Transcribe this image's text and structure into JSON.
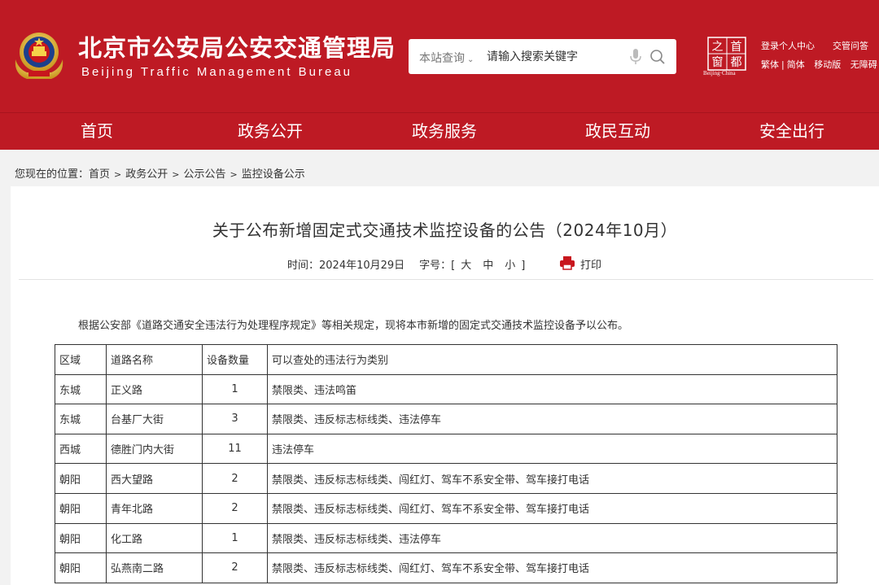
{
  "header": {
    "title": "北京市公安局公安交通管理局",
    "subtitle": "Beijing Traffic Management Bureau",
    "search": {
      "scope_label": "本站查询",
      "placeholder": "请输入搜索关键字"
    },
    "capital_logo_caption": "Beijing·China",
    "capital_logo_chars": [
      "之",
      "首",
      "窗",
      "都"
    ],
    "top_links": {
      "login": "登录个人中心",
      "faq": "交管问答",
      "traditional": "繁体",
      "simplified": "简体",
      "separator": "|",
      "mobile": "移动版",
      "accessible": "无障碍"
    },
    "colors": {
      "brand_red": "#be1a24"
    }
  },
  "nav": {
    "items": [
      "首页",
      "政务公开",
      "政务服务",
      "政民互动",
      "安全出行"
    ]
  },
  "breadcrumb": {
    "prefix": "您现在的位置：",
    "items": [
      "首页",
      "政务公开",
      "公示公告",
      "监控设备公示"
    ],
    "separator": ">"
  },
  "article": {
    "title": "关于公布新增固定式交通技术监控设备的公告（2024年10月）",
    "time_label": "时间：2024年10月29日",
    "font_size_label": "字号：[",
    "font_size_options": [
      "大",
      "中",
      "小"
    ],
    "font_size_close": "]",
    "print_label": "打印",
    "intro": "根据公安部《道路交通安全违法行为处理程序规定》等相关规定，现将本市新增的固定式交通技术监控设备予以公布。",
    "table": {
      "headers": [
        "区域",
        "道路名称",
        "设备数量",
        "可以查处的违法行为类别"
      ],
      "rows": [
        [
          "东城",
          "正义路",
          "1",
          "禁限类、违法鸣笛"
        ],
        [
          "东城",
          "台基厂大街",
          "3",
          "禁限类、违反标志标线类、违法停车"
        ],
        [
          "西城",
          "德胜门内大街",
          "11",
          "违法停车"
        ],
        [
          "朝阳",
          "西大望路",
          "2",
          "禁限类、违反标志标线类、闯红灯、驾车不系安全带、驾车接打电话"
        ],
        [
          "朝阳",
          "青年北路",
          "2",
          "禁限类、违反标志标线类、闯红灯、驾车不系安全带、驾车接打电话"
        ],
        [
          "朝阳",
          "化工路",
          "1",
          "禁限类、违反标志标线类、违法停车"
        ],
        [
          "朝阳",
          "弘燕南二路",
          "2",
          "禁限类、违反标志标线类、闯红灯、驾车不系安全带、驾车接打电话"
        ]
      ]
    }
  }
}
